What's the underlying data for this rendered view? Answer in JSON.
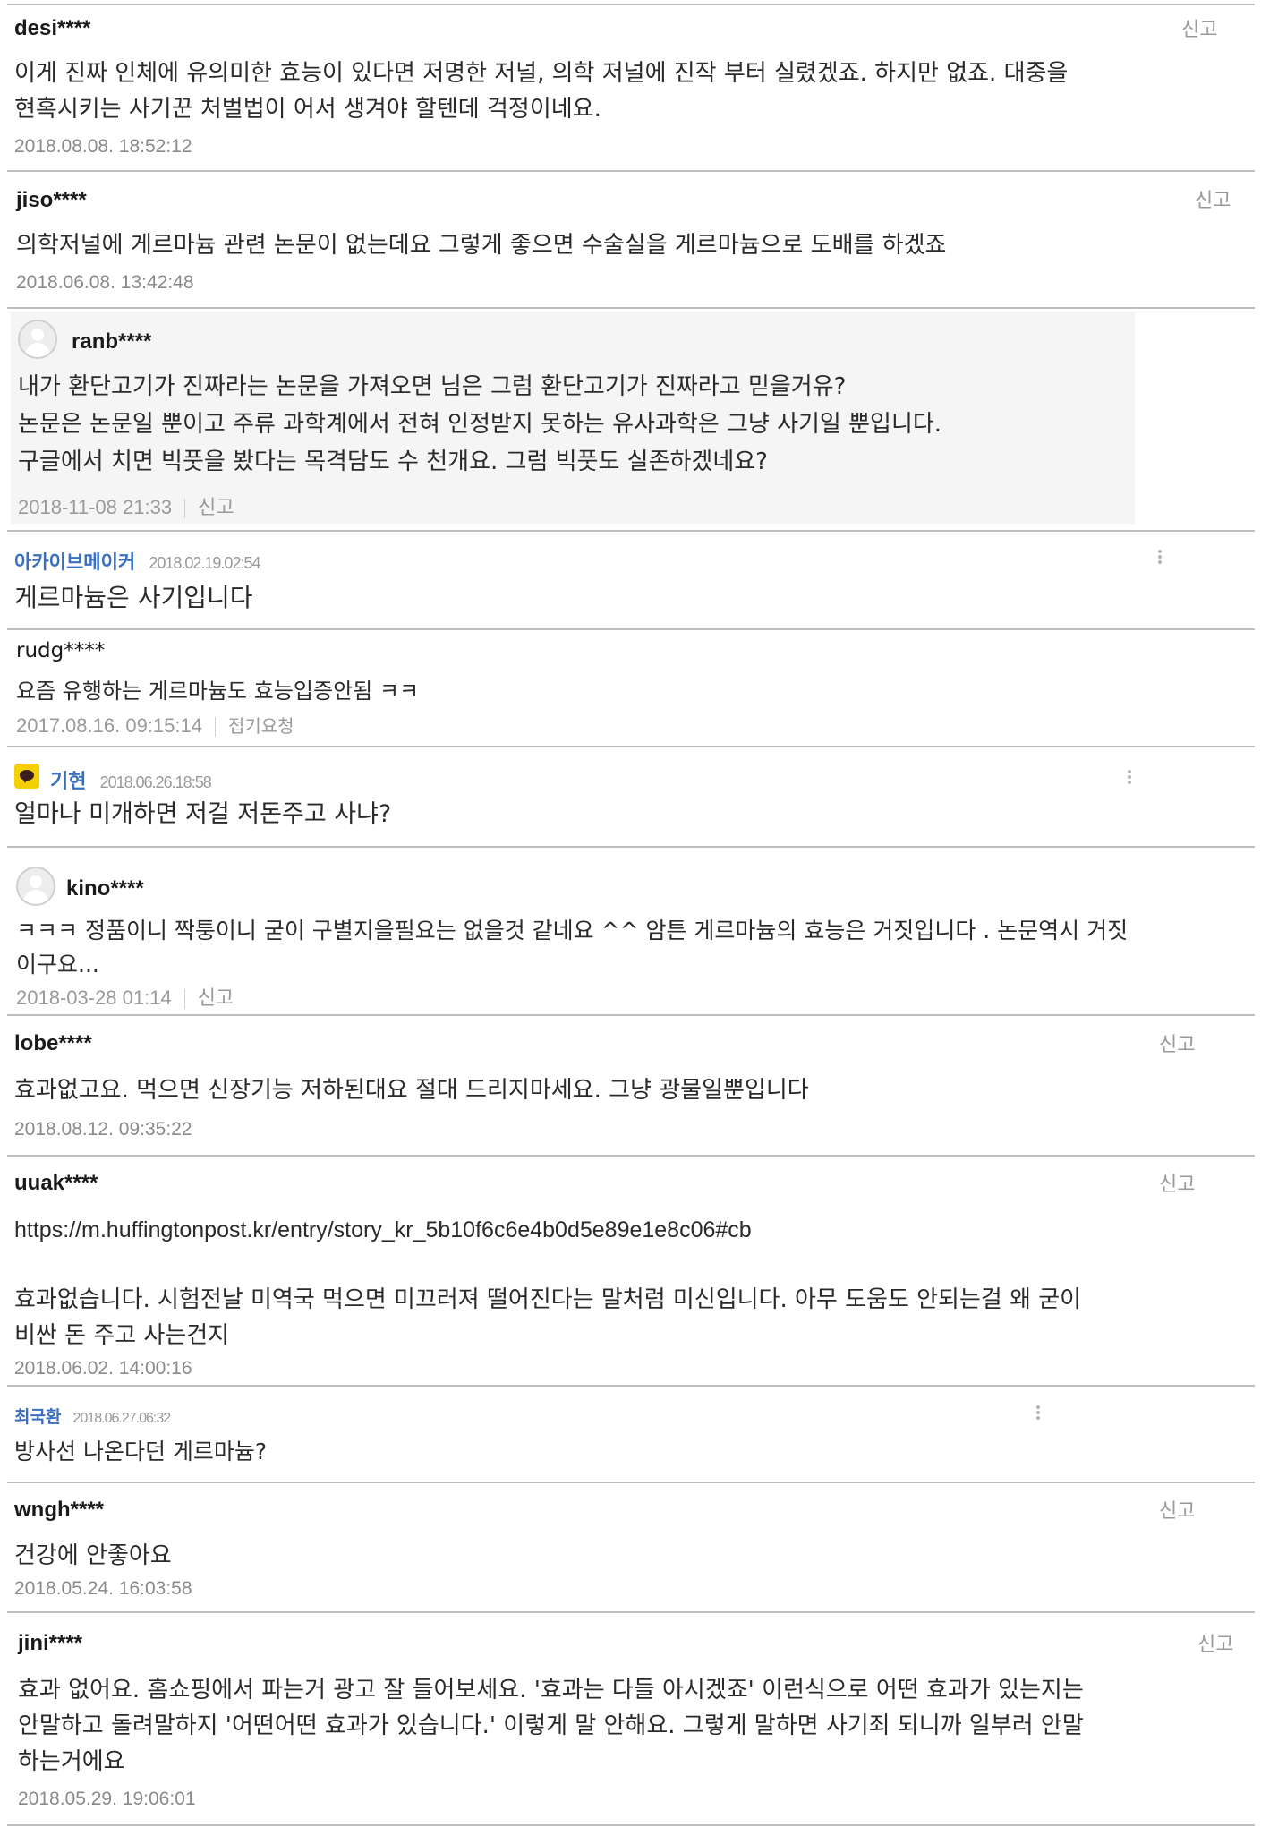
{
  "comments": [
    {
      "user": "desi****",
      "text": [
        "이게 진짜 인체에 유의미한 효능이 있다면 저명한 저널, 의학 저널에 진작 부터 실렸겠죠. 하지만 없죠. 대중을",
        "현혹시키는 사기꾼 처벌법이 어서 생겨야 할텐데 걱정이네요."
      ],
      "time": "2018.08.08. 18:52:12",
      "report": "신고"
    },
    {
      "user": "jiso****",
      "text": [
        "의학저널에 게르마늄 관련 논문이 없는데요 그렇게 좋으면 수술실을 게르마늄으로 도배를 하겠죠"
      ],
      "time": "2018.06.08. 13:42:48",
      "report": "신고"
    },
    {
      "user": "ranb****",
      "text": [
        "내가 환단고기가 진짜라는 논문을 가져오면 님은 그럼 환단고기가 진짜라고 믿을거유?",
        "논문은 논문일 뿐이고 주류 과학계에서 전혀 인정받지 못하는 유사과학은 그냥 사기일 뿐입니다.",
        "구글에서 치면 빅풋을 봤다는 목격담도 수 천개요. 그럼 빅풋도 실존하겠네요?"
      ],
      "time": "2018-11-08 21:33",
      "report": "신고"
    },
    {
      "user": "아카이브메이커",
      "text": [
        "게르마늄은 사기입니다"
      ],
      "time": "2018.02.19.02:54"
    },
    {
      "user": "rudg****",
      "text": [
        "요즘 유행하는 게르마늄도 효능입증안됨 ㅋㅋ"
      ],
      "time": "2017.08.16. 09:15:14",
      "report": "접기요청"
    },
    {
      "user": "기현",
      "text": [
        "얼마나 미개하면 저걸 저돈주고 사냐?"
      ],
      "time": "2018.06.26.18:58"
    },
    {
      "user": "kino****",
      "text": [
        "ㅋㅋㅋ 정품이니 짝퉁이니 굳이 구별지을필요는 없을것 같네요 ^^ 암튼 게르마늄의 효능은 거짓입니다 . 논문역시 거짓",
        "이구요..."
      ],
      "time": "2018-03-28 01:14",
      "report": "신고"
    },
    {
      "user": "lobe****",
      "text": [
        "효과없고요. 먹으면 신장기능 저하된대요 절대 드리지마세요. 그냥 광물일뿐입니다"
      ],
      "time": "2018.08.12. 09:35:22",
      "report": "신고"
    },
    {
      "user": "uuak****",
      "text": [
        "https://m.huffingtonpost.kr/entry/story_kr_5b10f6c6e4b0d5e89e1e8c06#cb",
        "",
        "효과없습니다. 시험전날 미역국 먹으면 미끄러져 떨어진다는 말처럼 미신입니다. 아무 도움도 안되는걸 왜 굳이",
        "비싼 돈 주고 사는건지"
      ],
      "time": "2018.06.02. 14:00:16",
      "report": "신고"
    },
    {
      "user": "최국환",
      "text": [
        "방사선 나온다던 게르마늄?"
      ],
      "time": "2018.06.27.06:32"
    },
    {
      "user": "wngh****",
      "text": [
        "건강에 안좋아요"
      ],
      "time": "2018.05.24. 16:03:58",
      "report": "신고"
    },
    {
      "user": "jini****",
      "text": [
        "효과 없어요. 홈쇼핑에서 파는거 광고 잘 들어보세요. '효과는 다들 아시겠죠' 이런식으로 어떤 효과가 있는지는",
        "안말하고 돌려말하지 '어떤어떤 효과가 있습니다.' 이렇게 말 안해요. 그렇게 말하면 사기죄 되니까 일부러 안말",
        "하는거에요"
      ],
      "time": "2018.05.29. 19:06:01",
      "report": "신고"
    }
  ]
}
